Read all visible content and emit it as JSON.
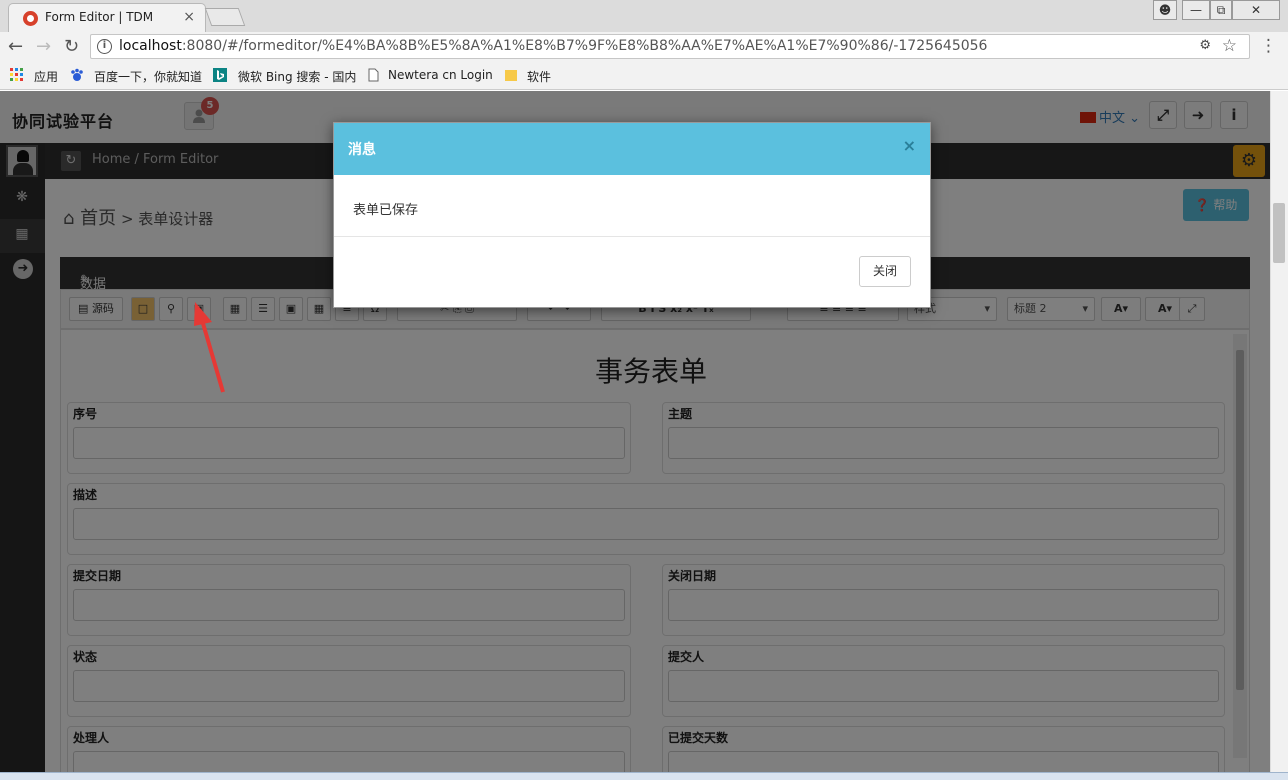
{
  "browser": {
    "tab_title": "Form Editor | TDM",
    "tab_close": "×",
    "url_host": "localhost",
    "url_rest": ":8080/#/formeditor/%E4%BA%8B%E5%8A%A1%E8%B7%9F%E8%B8%AA%E7%AE%A1%E7%90%86/-1725645056",
    "bookmarks": [
      {
        "label": "应用"
      },
      {
        "label": "百度一下，你就知道"
      },
      {
        "label": "微软 Bing 搜索 - 国内"
      },
      {
        "label": "Newtera cn Login"
      },
      {
        "label": "软件"
      }
    ]
  },
  "app": {
    "brand": "协同试验平台",
    "notif_count": "5",
    "lang": "中文",
    "breadcrumb": "Home /  Form Editor",
    "page_title_home": "首页",
    "page_title_sub": " > 表单设计器",
    "help_label": "帮助",
    "panel_title": "数据类：事务；表单名称：default",
    "toolbar": {
      "source_label": "源码",
      "style_select": "样式",
      "heading_select": "标题 2"
    }
  },
  "form": {
    "title": "事务表单",
    "fields": [
      {
        "label": "序号"
      },
      {
        "label": "主题"
      },
      {
        "label": "描述"
      },
      {
        "label": "提交日期"
      },
      {
        "label": "关闭日期"
      },
      {
        "label": "状态"
      },
      {
        "label": "提交人"
      },
      {
        "label": "处理人"
      },
      {
        "label": "已提交天数"
      }
    ]
  },
  "modal": {
    "title": "消息",
    "close_x": "×",
    "message": "表单已保存",
    "close_button": "关闭"
  },
  "colors": {
    "modal_header": "#5bc0de",
    "annotation_arrow": "#e53935",
    "notif_badge": "#d9534f"
  }
}
